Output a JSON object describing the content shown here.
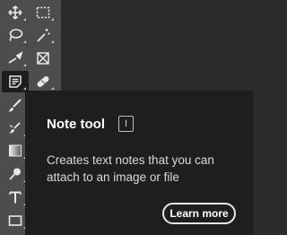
{
  "tooltip": {
    "title": "Note tool",
    "shortcut": "I",
    "description": "Creates text notes that you can attach to an image or file",
    "button_label": "Learn more"
  },
  "toolbar": {
    "tools": [
      "move-tool",
      "rectangular-marquee-tool",
      "lasso-tool",
      "magic-wand-tool",
      "eyedropper-tool",
      "frame-tool",
      "note-tool",
      "healing-brush-tool",
      "brush-tool",
      "clone-stamp-tool",
      "gradient-tool",
      "dodge-tool",
      "type-tool",
      "rectangle-tool"
    ],
    "active_tool": "note-tool"
  },
  "colors": {
    "toolbar_bg": "#4d4d4d",
    "tooltip_bg": "#1e1e1e",
    "canvas_bg": "#2b2b2b"
  }
}
